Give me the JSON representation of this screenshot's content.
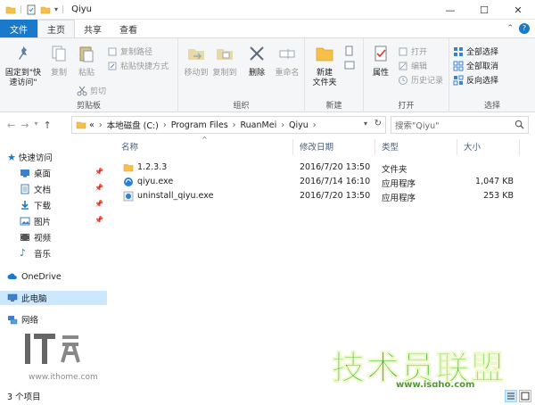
{
  "window": {
    "title": "Qiyu",
    "controls": {
      "minimize": "—",
      "maximize": "☐",
      "close": "✕"
    }
  },
  "tabs": {
    "file": "文件",
    "home": "主页",
    "share": "共享",
    "view": "查看"
  },
  "ribbon": {
    "clipboard": {
      "label": "剪贴板",
      "pin": "固定到\"快速访问\"",
      "copy": "复制",
      "paste": "粘贴",
      "copy_path": "复制路径",
      "paste_shortcut": "粘贴快捷方式",
      "cut": "剪切"
    },
    "organize": {
      "label": "组织",
      "move_to": "移动到",
      "copy_to": "复制到",
      "delete": "删除",
      "rename": "重命名"
    },
    "new": {
      "label": "新建",
      "new_folder": "新建\n文件夹"
    },
    "open": {
      "label": "打开",
      "properties": "属性",
      "open": "打开",
      "edit": "编辑",
      "history": "历史记录"
    },
    "select": {
      "label": "选择",
      "select_all": "全部选择",
      "select_none": "全部取消",
      "invert": "反向选择"
    }
  },
  "address": {
    "overflow": "«",
    "crumbs": [
      "本地磁盘 (C:)",
      "Program Files",
      "RuanMei",
      "Qiyu"
    ]
  },
  "search": {
    "placeholder": "搜索\"Qiyu\""
  },
  "navpane": {
    "quick_access": "快速访问",
    "desktop": "桌面",
    "documents": "文档",
    "downloads": "下载",
    "pictures": "图片",
    "videos": "视频",
    "music": "音乐",
    "onedrive": "OneDrive",
    "this_pc": "此电脑",
    "network": "网络"
  },
  "columns": {
    "name": "名称",
    "date": "修改日期",
    "type": "类型",
    "size": "大小"
  },
  "files": [
    {
      "name": "1.2.3.3",
      "date": "2016/7/20 13:50",
      "type": "文件夹",
      "size": ""
    },
    {
      "name": "qiyu.exe",
      "date": "2016/7/14 16:10",
      "type": "应用程序",
      "size": "1,047 KB"
    },
    {
      "name": "uninstall_qiyu.exe",
      "date": "2016/7/20 13:50",
      "type": "应用程序",
      "size": "253 KB"
    }
  ],
  "status": {
    "count": "3 个项目"
  },
  "watermarks": {
    "ithome_url": "www.ithome.com",
    "jsgho_text": "技术员联盟",
    "jsgho_url": "www.jsgho.com"
  },
  "colors": {
    "accent": "#1979ca",
    "selection": "#cce8ff",
    "folder": "#f4c04a",
    "watermark_green": "#2aa52b"
  }
}
